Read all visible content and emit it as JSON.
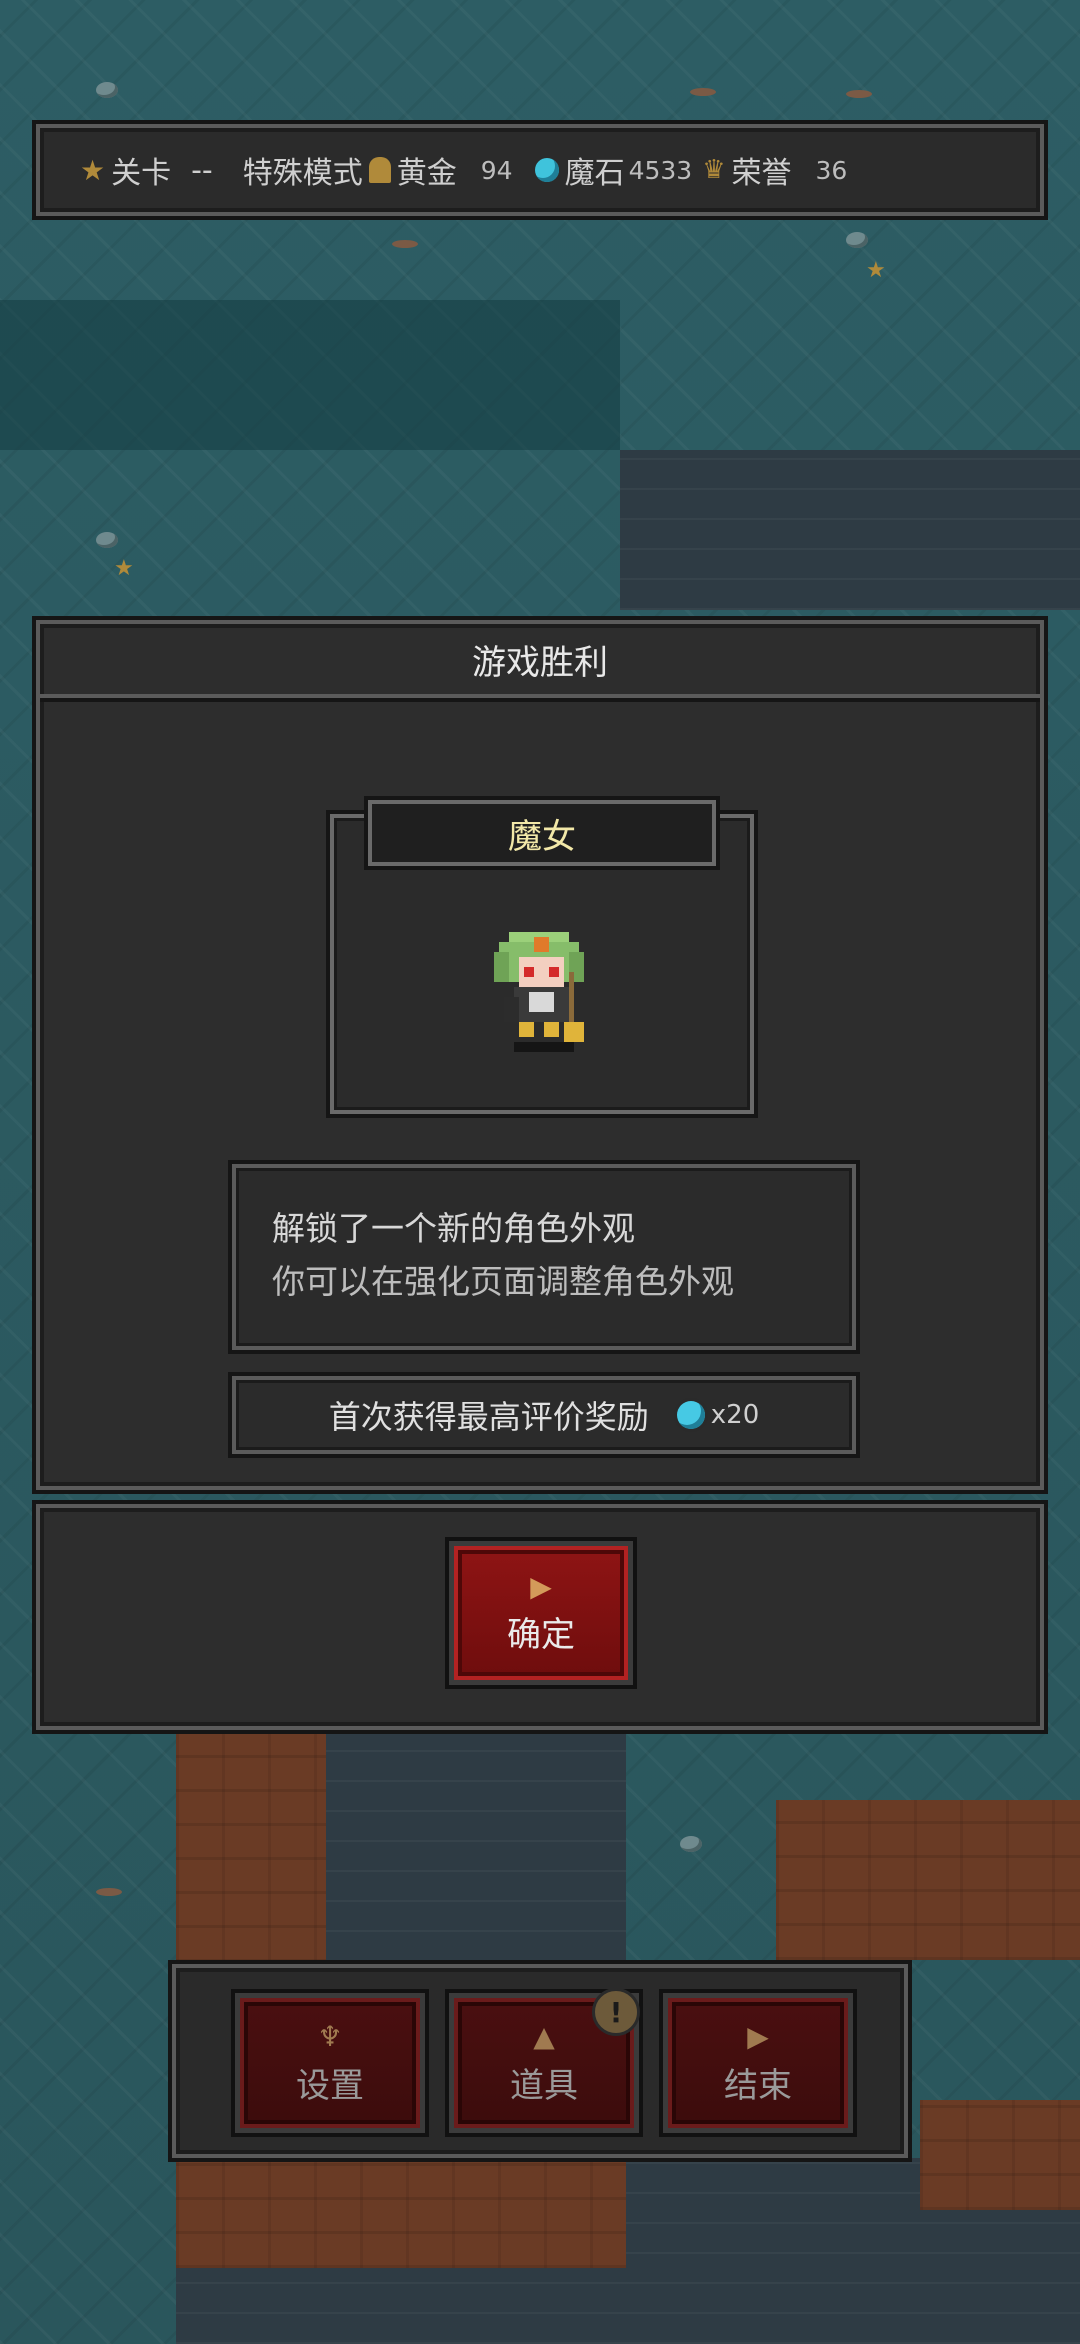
{
  "topbar": {
    "stage_label": "关卡",
    "stage_value": "--",
    "mode": "特殊模式",
    "gold_label": "黄金",
    "gold_value": "94",
    "magic_stone_label": "魔石",
    "magic_stone_value": "4533",
    "honor_label": "荣誉",
    "honor_value": "36"
  },
  "dialog": {
    "title": "游戏胜利",
    "character_name": "魔女",
    "info_line1": "解锁了一个新的角色外观",
    "info_line2": "你可以在强化页面调整角色外观",
    "reward_text": "首次获得最高评价奖励",
    "reward_value": "x20"
  },
  "confirm": {
    "label": "确定"
  },
  "bottom_menu": {
    "settings_label": "设置",
    "items_label": "道具",
    "items_alert": "!",
    "end_label": "结束"
  },
  "colors": {
    "accent_gold": "#b08a3a",
    "gem_blue": "#3fc3dc",
    "button_red": "#8e1414",
    "name_yellow": "#f2e8a8"
  },
  "icons": [
    "star-icon",
    "gold-icon",
    "magic-stone-icon",
    "honor-crown-icon",
    "play-icon",
    "wrench-icon",
    "potion-icon",
    "alert-icon"
  ]
}
